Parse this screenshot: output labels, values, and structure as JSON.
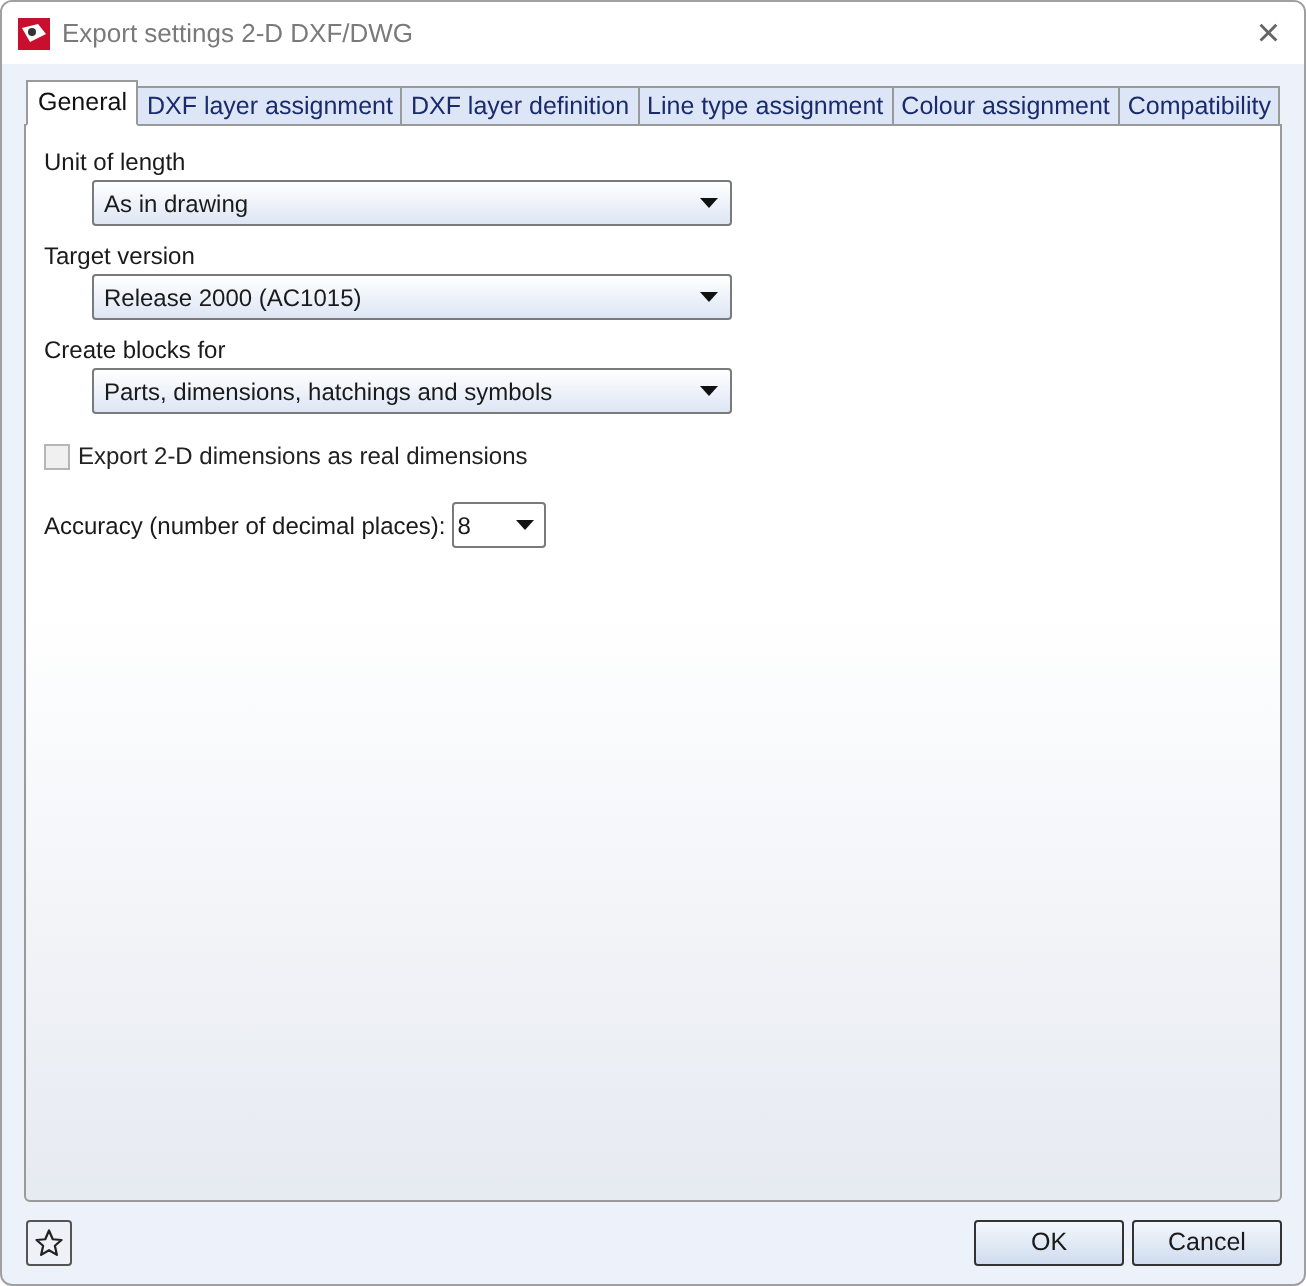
{
  "window": {
    "title": "Export settings 2-D DXF/DWG",
    "close": "×"
  },
  "tabs": [
    {
      "label": "General",
      "selected": true
    },
    {
      "label": "DXF layer assignment",
      "selected": false
    },
    {
      "label": "DXF layer definition",
      "selected": false
    },
    {
      "label": "Line type assignment",
      "selected": false
    },
    {
      "label": "Colour assignment",
      "selected": false
    },
    {
      "label": "Compatibility",
      "selected": false
    }
  ],
  "fields": [
    {
      "label": "Unit of length",
      "value": "As in drawing"
    },
    {
      "label": "Target version",
      "value": "Release 2000 (AC1015)"
    },
    {
      "label": "Create blocks for",
      "value": "Parts, dimensions, hatchings and symbols"
    }
  ],
  "checkbox": {
    "label": "Export 2-D dimensions as real dimensions",
    "checked": false
  },
  "accuracy": {
    "label": "Accuracy (number of decimal places):",
    "value": "8"
  },
  "buttons": [
    "OK",
    "Cancel"
  ]
}
